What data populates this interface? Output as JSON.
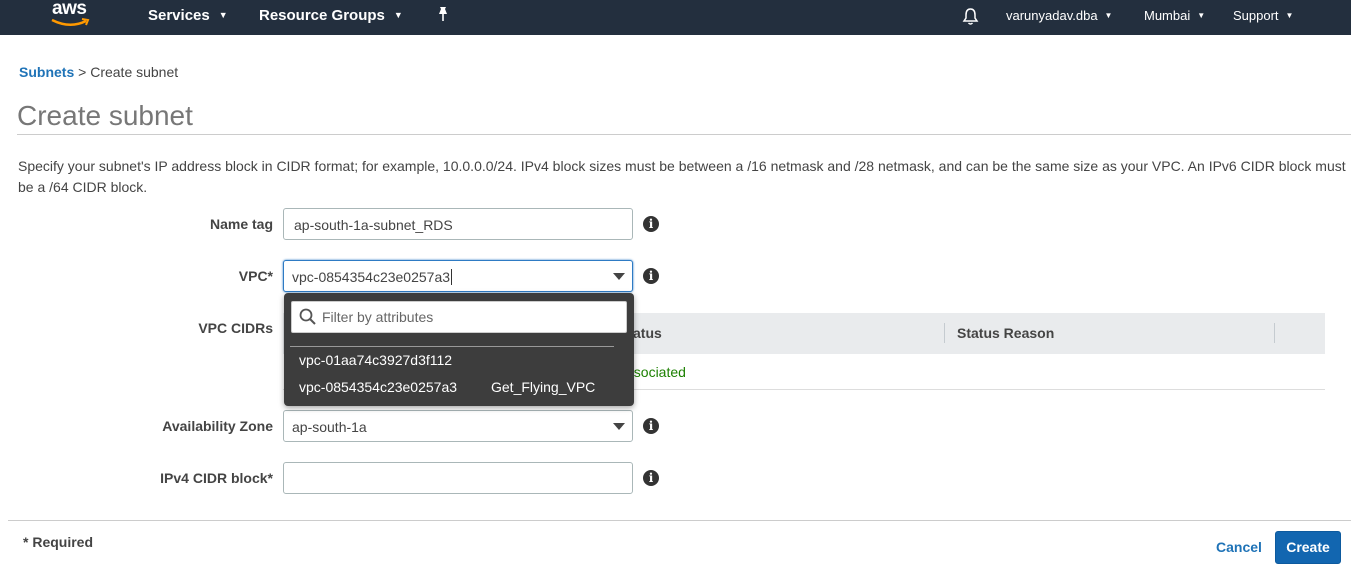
{
  "nav": {
    "logo": "aws",
    "services": "Services",
    "resource_groups": "Resource Groups",
    "pin_icon": "pin-icon",
    "bell_icon": "bell-icon",
    "account": "varunyadav.dba",
    "region": "Mumbai",
    "support": "Support"
  },
  "breadcrumb": {
    "parent": "Subnets",
    "separator": ">",
    "current": "Create subnet"
  },
  "page": {
    "title": "Create subnet",
    "description": "Specify your subnet's IP address block in CIDR format; for example, 10.0.0.0/24. IPv4 block sizes must be between a /16 netmask and /28 netmask, and can be the same size as your VPC. An IPv6 CIDR block must be a /64 CIDR block."
  },
  "form": {
    "name_tag": {
      "label": "Name tag",
      "value": "ap-south-1a-subnet_RDS"
    },
    "vpc": {
      "label": "VPC*",
      "value": "vpc-0854354c23e0257a3"
    },
    "vpc_cidrs": {
      "label": "VPC CIDRs",
      "columns": [
        "Status",
        "Status Reason"
      ],
      "row_status": "associated"
    },
    "availability_zone": {
      "label": "Availability Zone",
      "value": "ap-south-1a"
    },
    "ipv4_cidr": {
      "label": "IPv4 CIDR block*",
      "value": ""
    }
  },
  "dropdown": {
    "filter_placeholder": "Filter by attributes",
    "options": [
      {
        "id": "vpc-01aa74c3927d3f112",
        "name": ""
      },
      {
        "id": "vpc-0854354c23e0257a3",
        "name": "Get_Flying_VPC"
      }
    ]
  },
  "footer": {
    "required_note": "* Required",
    "cancel_label": "Cancel",
    "create_label": "Create"
  },
  "colors": {
    "nav_bg": "#232f3e",
    "link": "#1f73b7",
    "primary_button": "#1266b0",
    "status_ok": "#1d8102"
  }
}
